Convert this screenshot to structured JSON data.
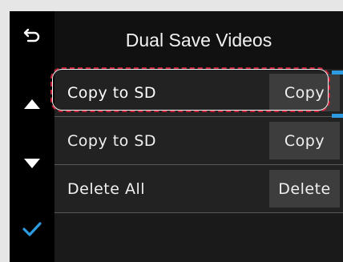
{
  "screen": {
    "title": "Dual Save Videos",
    "rows": [
      {
        "label": "Copy to SD",
        "action": "Copy"
      },
      {
        "label": "Copy to SD",
        "action": "Copy"
      },
      {
        "label": "Delete All",
        "action": "Delete"
      }
    ]
  },
  "sidebar": {
    "back_icon": "back-arrow-icon",
    "up_icon": "up-triangle-icon",
    "down_icon": "down-triangle-icon",
    "ok_icon": "checkmark-icon"
  },
  "colors": {
    "accent": "#2e9be0",
    "highlight": "#c8223a"
  }
}
